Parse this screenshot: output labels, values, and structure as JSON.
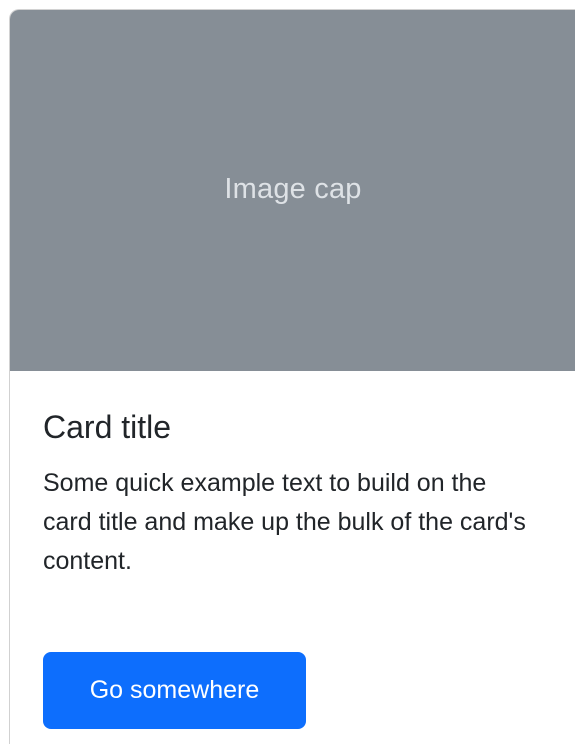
{
  "card": {
    "image_cap": "Image cap",
    "title": "Card title",
    "text": "Some quick example text to build on the card title and make up the bulk of the card's content.",
    "button_label": "Go somewhere"
  },
  "colors": {
    "image_cap_background": "#868e96",
    "image_cap_text": "#dee2e6",
    "primary_button": "#0d6efd",
    "body_text": "#212529",
    "button_text": "#ffffff"
  }
}
